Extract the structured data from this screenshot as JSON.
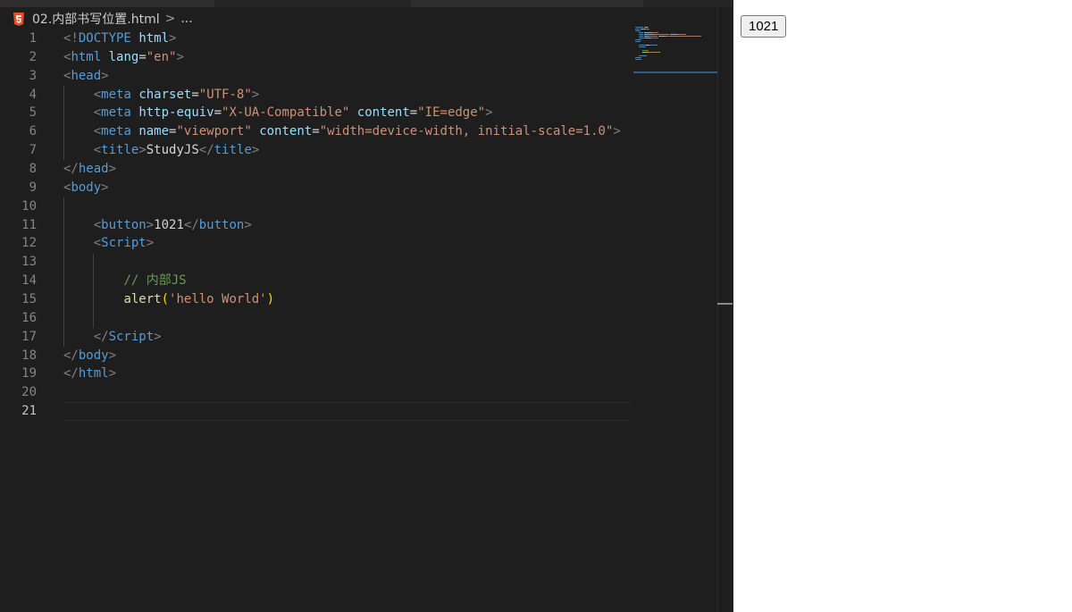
{
  "breadcrumb": {
    "filename": "02.内部书写位置.html",
    "separator": ">",
    "ellipsis": "..."
  },
  "active_line": "21",
  "lines": [
    {
      "n": "1",
      "tokens": [
        [
          "t-punct",
          "<!"
        ],
        [
          "t-tag",
          "DOCTYPE"
        ],
        [
          "t-text",
          " "
        ],
        [
          "t-attr",
          "html"
        ],
        [
          "t-punct",
          ">"
        ]
      ]
    },
    {
      "n": "2",
      "tokens": [
        [
          "t-punct",
          "<"
        ],
        [
          "t-tag",
          "html"
        ],
        [
          "t-text",
          " "
        ],
        [
          "t-attr",
          "lang"
        ],
        [
          "t-text",
          "="
        ],
        [
          "t-str",
          "\"en\""
        ],
        [
          "t-punct",
          ">"
        ]
      ]
    },
    {
      "n": "3",
      "tokens": [
        [
          "t-punct",
          "<"
        ],
        [
          "t-tag",
          "head"
        ],
        [
          "t-punct",
          ">"
        ]
      ]
    },
    {
      "n": "4",
      "tokens": [
        [
          "t-text",
          "    "
        ],
        [
          "t-punct",
          "<"
        ],
        [
          "t-tag",
          "meta"
        ],
        [
          "t-text",
          " "
        ],
        [
          "t-attr",
          "charset"
        ],
        [
          "t-text",
          "="
        ],
        [
          "t-str",
          "\"UTF-8\""
        ],
        [
          "t-punct",
          ">"
        ]
      ]
    },
    {
      "n": "5",
      "tokens": [
        [
          "t-text",
          "    "
        ],
        [
          "t-punct",
          "<"
        ],
        [
          "t-tag",
          "meta"
        ],
        [
          "t-text",
          " "
        ],
        [
          "t-attr",
          "http-equiv"
        ],
        [
          "t-text",
          "="
        ],
        [
          "t-str",
          "\"X-UA-Compatible\""
        ],
        [
          "t-text",
          " "
        ],
        [
          "t-attr",
          "content"
        ],
        [
          "t-text",
          "="
        ],
        [
          "t-str",
          "\"IE=edge\""
        ],
        [
          "t-punct",
          ">"
        ]
      ]
    },
    {
      "n": "6",
      "tokens": [
        [
          "t-text",
          "    "
        ],
        [
          "t-punct",
          "<"
        ],
        [
          "t-tag",
          "meta"
        ],
        [
          "t-text",
          " "
        ],
        [
          "t-attr",
          "name"
        ],
        [
          "t-text",
          "="
        ],
        [
          "t-str",
          "\"viewport\""
        ],
        [
          "t-text",
          " "
        ],
        [
          "t-attr",
          "content"
        ],
        [
          "t-text",
          "="
        ],
        [
          "t-str",
          "\"width=device-width, initial-scale=1.0\""
        ],
        [
          "t-punct",
          ">"
        ]
      ]
    },
    {
      "n": "7",
      "tokens": [
        [
          "t-text",
          "    "
        ],
        [
          "t-punct",
          "<"
        ],
        [
          "t-tag",
          "title"
        ],
        [
          "t-punct",
          ">"
        ],
        [
          "t-text",
          "StudyJS"
        ],
        [
          "t-punct",
          "</"
        ],
        [
          "t-tag",
          "title"
        ],
        [
          "t-punct",
          ">"
        ]
      ]
    },
    {
      "n": "8",
      "tokens": [
        [
          "t-punct",
          "</"
        ],
        [
          "t-tag",
          "head"
        ],
        [
          "t-punct",
          ">"
        ]
      ]
    },
    {
      "n": "9",
      "tokens": [
        [
          "t-punct",
          "<"
        ],
        [
          "t-tag",
          "body"
        ],
        [
          "t-punct",
          ">"
        ]
      ]
    },
    {
      "n": "10",
      "tokens": []
    },
    {
      "n": "11",
      "tokens": [
        [
          "t-text",
          "    "
        ],
        [
          "t-punct",
          "<"
        ],
        [
          "t-tag",
          "button"
        ],
        [
          "t-punct",
          ">"
        ],
        [
          "t-text",
          "1021"
        ],
        [
          "t-punct",
          "</"
        ],
        [
          "t-tag",
          "button"
        ],
        [
          "t-punct",
          ">"
        ]
      ]
    },
    {
      "n": "12",
      "tokens": [
        [
          "t-text",
          "    "
        ],
        [
          "t-punct",
          "<"
        ],
        [
          "t-tag",
          "Script"
        ],
        [
          "t-punct",
          ">"
        ]
      ]
    },
    {
      "n": "13",
      "tokens": []
    },
    {
      "n": "14",
      "tokens": [
        [
          "t-text",
          "        "
        ],
        [
          "t-cmt",
          "// 内部JS"
        ]
      ]
    },
    {
      "n": "15",
      "tokens": [
        [
          "t-text",
          "        "
        ],
        [
          "t-fn",
          "alert"
        ],
        [
          "t-brk",
          "("
        ],
        [
          "t-str",
          "'hello World'"
        ],
        [
          "t-brk",
          ")"
        ]
      ]
    },
    {
      "n": "16",
      "tokens": []
    },
    {
      "n": "17",
      "tokens": [
        [
          "t-text",
          "    "
        ],
        [
          "t-punct",
          "</"
        ],
        [
          "t-tag",
          "Script"
        ],
        [
          "t-punct",
          ">"
        ]
      ]
    },
    {
      "n": "18",
      "tokens": [
        [
          "t-punct",
          "</"
        ],
        [
          "t-tag",
          "body"
        ],
        [
          "t-punct",
          ">"
        ]
      ]
    },
    {
      "n": "19",
      "tokens": [
        [
          "t-punct",
          "</"
        ],
        [
          "t-tag",
          "html"
        ],
        [
          "t-punct",
          ">"
        ]
      ]
    },
    {
      "n": "20",
      "tokens": []
    },
    {
      "n": "21",
      "tokens": []
    }
  ],
  "preview": {
    "button_label": "1021"
  },
  "colors": {
    "editor_bg": "#1e1e1e",
    "tag": "#569cd6",
    "attr": "#9cdcfe",
    "string": "#ce9178",
    "comment": "#6a9955",
    "function": "#dcdcaa"
  }
}
